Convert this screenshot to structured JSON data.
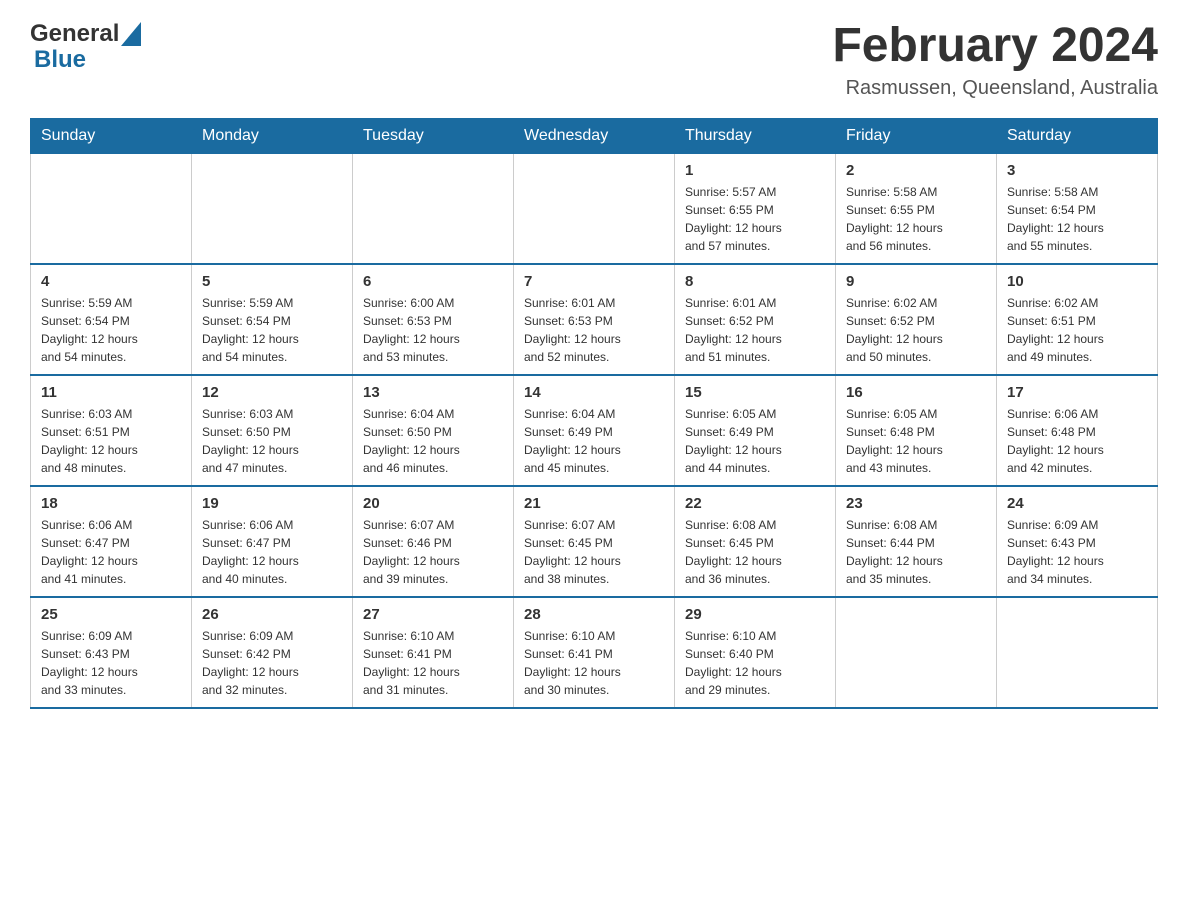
{
  "header": {
    "logo_general": "General",
    "logo_blue": "Blue",
    "title": "February 2024",
    "subtitle": "Rasmussen, Queensland, Australia"
  },
  "days_of_week": [
    "Sunday",
    "Monday",
    "Tuesday",
    "Wednesday",
    "Thursday",
    "Friday",
    "Saturday"
  ],
  "weeks": [
    {
      "days": [
        {
          "number": "",
          "info": ""
        },
        {
          "number": "",
          "info": ""
        },
        {
          "number": "",
          "info": ""
        },
        {
          "number": "",
          "info": ""
        },
        {
          "number": "1",
          "info": "Sunrise: 5:57 AM\nSunset: 6:55 PM\nDaylight: 12 hours\nand 57 minutes."
        },
        {
          "number": "2",
          "info": "Sunrise: 5:58 AM\nSunset: 6:55 PM\nDaylight: 12 hours\nand 56 minutes."
        },
        {
          "number": "3",
          "info": "Sunrise: 5:58 AM\nSunset: 6:54 PM\nDaylight: 12 hours\nand 55 minutes."
        }
      ]
    },
    {
      "days": [
        {
          "number": "4",
          "info": "Sunrise: 5:59 AM\nSunset: 6:54 PM\nDaylight: 12 hours\nand 54 minutes."
        },
        {
          "number": "5",
          "info": "Sunrise: 5:59 AM\nSunset: 6:54 PM\nDaylight: 12 hours\nand 54 minutes."
        },
        {
          "number": "6",
          "info": "Sunrise: 6:00 AM\nSunset: 6:53 PM\nDaylight: 12 hours\nand 53 minutes."
        },
        {
          "number": "7",
          "info": "Sunrise: 6:01 AM\nSunset: 6:53 PM\nDaylight: 12 hours\nand 52 minutes."
        },
        {
          "number": "8",
          "info": "Sunrise: 6:01 AM\nSunset: 6:52 PM\nDaylight: 12 hours\nand 51 minutes."
        },
        {
          "number": "9",
          "info": "Sunrise: 6:02 AM\nSunset: 6:52 PM\nDaylight: 12 hours\nand 50 minutes."
        },
        {
          "number": "10",
          "info": "Sunrise: 6:02 AM\nSunset: 6:51 PM\nDaylight: 12 hours\nand 49 minutes."
        }
      ]
    },
    {
      "days": [
        {
          "number": "11",
          "info": "Sunrise: 6:03 AM\nSunset: 6:51 PM\nDaylight: 12 hours\nand 48 minutes."
        },
        {
          "number": "12",
          "info": "Sunrise: 6:03 AM\nSunset: 6:50 PM\nDaylight: 12 hours\nand 47 minutes."
        },
        {
          "number": "13",
          "info": "Sunrise: 6:04 AM\nSunset: 6:50 PM\nDaylight: 12 hours\nand 46 minutes."
        },
        {
          "number": "14",
          "info": "Sunrise: 6:04 AM\nSunset: 6:49 PM\nDaylight: 12 hours\nand 45 minutes."
        },
        {
          "number": "15",
          "info": "Sunrise: 6:05 AM\nSunset: 6:49 PM\nDaylight: 12 hours\nand 44 minutes."
        },
        {
          "number": "16",
          "info": "Sunrise: 6:05 AM\nSunset: 6:48 PM\nDaylight: 12 hours\nand 43 minutes."
        },
        {
          "number": "17",
          "info": "Sunrise: 6:06 AM\nSunset: 6:48 PM\nDaylight: 12 hours\nand 42 minutes."
        }
      ]
    },
    {
      "days": [
        {
          "number": "18",
          "info": "Sunrise: 6:06 AM\nSunset: 6:47 PM\nDaylight: 12 hours\nand 41 minutes."
        },
        {
          "number": "19",
          "info": "Sunrise: 6:06 AM\nSunset: 6:47 PM\nDaylight: 12 hours\nand 40 minutes."
        },
        {
          "number": "20",
          "info": "Sunrise: 6:07 AM\nSunset: 6:46 PM\nDaylight: 12 hours\nand 39 minutes."
        },
        {
          "number": "21",
          "info": "Sunrise: 6:07 AM\nSunset: 6:45 PM\nDaylight: 12 hours\nand 38 minutes."
        },
        {
          "number": "22",
          "info": "Sunrise: 6:08 AM\nSunset: 6:45 PM\nDaylight: 12 hours\nand 36 minutes."
        },
        {
          "number": "23",
          "info": "Sunrise: 6:08 AM\nSunset: 6:44 PM\nDaylight: 12 hours\nand 35 minutes."
        },
        {
          "number": "24",
          "info": "Sunrise: 6:09 AM\nSunset: 6:43 PM\nDaylight: 12 hours\nand 34 minutes."
        }
      ]
    },
    {
      "days": [
        {
          "number": "25",
          "info": "Sunrise: 6:09 AM\nSunset: 6:43 PM\nDaylight: 12 hours\nand 33 minutes."
        },
        {
          "number": "26",
          "info": "Sunrise: 6:09 AM\nSunset: 6:42 PM\nDaylight: 12 hours\nand 32 minutes."
        },
        {
          "number": "27",
          "info": "Sunrise: 6:10 AM\nSunset: 6:41 PM\nDaylight: 12 hours\nand 31 minutes."
        },
        {
          "number": "28",
          "info": "Sunrise: 6:10 AM\nSunset: 6:41 PM\nDaylight: 12 hours\nand 30 minutes."
        },
        {
          "number": "29",
          "info": "Sunrise: 6:10 AM\nSunset: 6:40 PM\nDaylight: 12 hours\nand 29 minutes."
        },
        {
          "number": "",
          "info": ""
        },
        {
          "number": "",
          "info": ""
        }
      ]
    }
  ]
}
